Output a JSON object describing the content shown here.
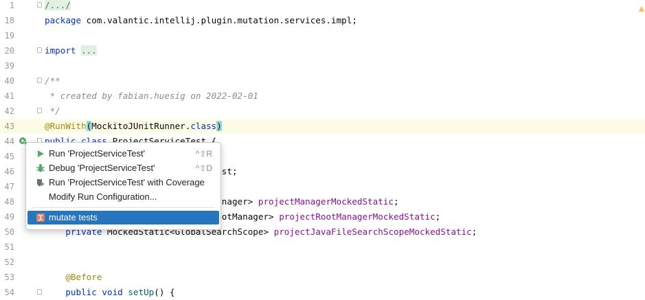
{
  "editor": {
    "lines": [
      {
        "num": "1",
        "tokens": [
          {
            "t": "/.../",
            "c": "fold-bg"
          }
        ],
        "fold": true
      },
      {
        "num": "18",
        "tokens": [
          {
            "t": "package",
            "c": "kw"
          },
          {
            "t": " com.valantic.intellij.plugin.mutation.services.impl;"
          }
        ]
      },
      {
        "num": "19",
        "tokens": []
      },
      {
        "num": "20",
        "tokens": [
          {
            "t": "import",
            "c": "kw"
          },
          {
            "t": " "
          },
          {
            "t": "...",
            "c": "fold-bg"
          }
        ],
        "fold": true
      },
      {
        "num": "39",
        "tokens": []
      },
      {
        "num": "40",
        "tokens": [
          {
            "t": "/**",
            "c": "cmt"
          }
        ],
        "fold": true
      },
      {
        "num": "41",
        "tokens": [
          {
            "t": " * created by fabian.huesig on 2022-02-01",
            "c": "cmt"
          }
        ]
      },
      {
        "num": "42",
        "tokens": [
          {
            "t": " */",
            "c": "cmt"
          }
        ],
        "fold": true
      },
      {
        "num": "43",
        "tokens": [
          {
            "t": "@RunWith",
            "c": "ann"
          },
          {
            "t": "(",
            "c": "paren-hl"
          },
          {
            "t": "MockitoJUnitRunner."
          },
          {
            "t": "class",
            "c": "kw"
          },
          {
            "t": ")",
            "c": "paren-hl"
          }
        ],
        "caret": true
      },
      {
        "num": "44",
        "tokens": [
          {
            "t": "public class",
            "c": "kw"
          },
          {
            "t": " ProjectServiceTest {"
          }
        ],
        "fold": true
      },
      {
        "num": "45",
        "tokens": []
      },
      {
        "num": "46",
        "tokens": [
          {
            "t": "                                 "
          },
          {
            "t": "est;"
          }
        ]
      },
      {
        "num": "47",
        "tokens": []
      },
      {
        "num": "48",
        "tokens": [
          {
            "t": "                                Manager> "
          },
          {
            "t": "projectManagerMockedStatic",
            "c": "fld"
          },
          {
            "t": ";"
          }
        ]
      },
      {
        "num": "49",
        "tokens": [
          {
            "t": "                                RootManager> "
          },
          {
            "t": "projectRootManagerMockedStatic",
            "c": "fld"
          },
          {
            "t": ";"
          }
        ]
      },
      {
        "num": "50",
        "tokens": [
          {
            "t": "    "
          },
          {
            "t": "private",
            "c": "kw"
          },
          {
            "t": " MockedStatic<GlobalSearchScope> "
          },
          {
            "t": "projectJavaFileSearchScopeMockedStatic",
            "c": "fld"
          },
          {
            "t": ";"
          }
        ]
      },
      {
        "num": "51",
        "tokens": []
      },
      {
        "num": "52",
        "tokens": []
      },
      {
        "num": "53",
        "tokens": [
          {
            "t": "    "
          },
          {
            "t": "@Before",
            "c": "ann"
          }
        ]
      },
      {
        "num": "54",
        "tokens": [
          {
            "t": "    "
          },
          {
            "t": "public void",
            "c": "kw"
          },
          {
            "t": " "
          },
          {
            "t": "setUp",
            "c": "fn"
          },
          {
            "t": "() {"
          }
        ],
        "fold": true
      }
    ]
  },
  "popup": {
    "items": [
      {
        "label": "Run 'ProjectServiceTest'",
        "shortcut": "^⇧R",
        "icon": "run-icon"
      },
      {
        "label": "Debug 'ProjectServiceTest'",
        "shortcut": "^⇧D",
        "icon": "debug-icon"
      },
      {
        "label": "Run 'ProjectServiceTest' with Coverage",
        "shortcut": "",
        "icon": "coverage-icon"
      },
      {
        "label": "Modify Run Configuration...",
        "shortcut": "",
        "icon": ""
      },
      {
        "label": "mutate tests",
        "shortcut": "",
        "icon": "mutation-icon",
        "selected": true
      }
    ]
  },
  "colors": {
    "keyword": "#0033b3",
    "annotation": "#9e880d",
    "comment": "#8c8c8c",
    "field": "#871094",
    "selection": "#2675bf",
    "caret_line": "#fcfbe6"
  }
}
